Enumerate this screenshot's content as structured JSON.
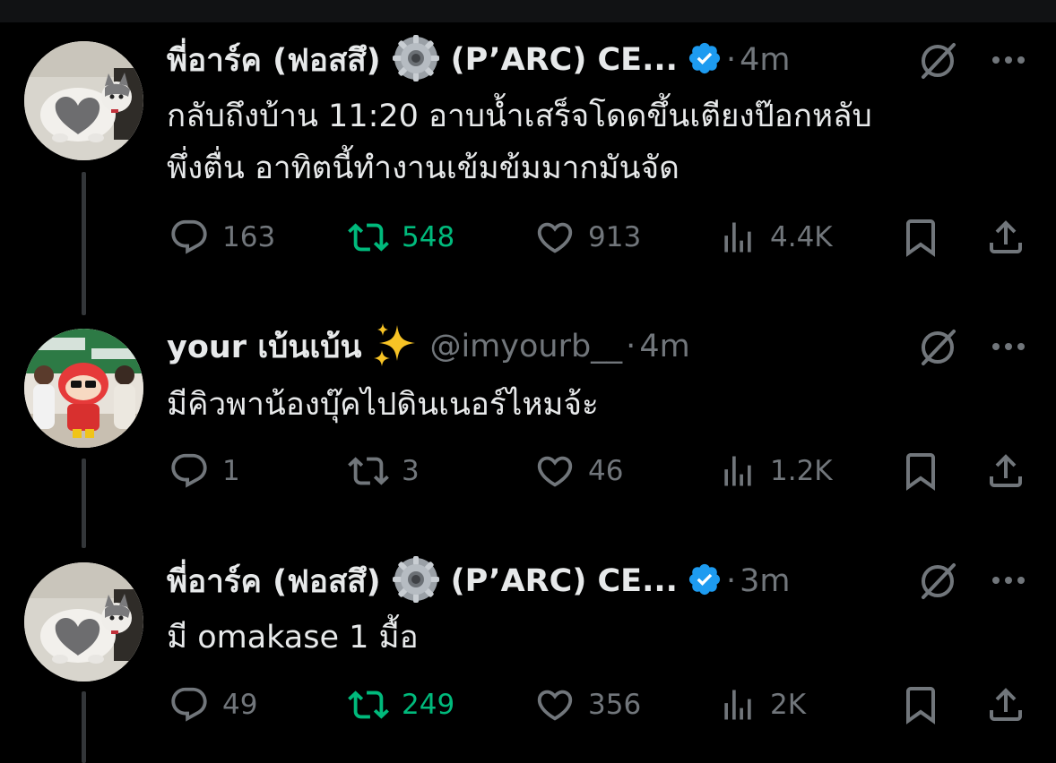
{
  "tweets": [
    {
      "name": "พี่อาร์ค (ฟอสสึ) ⚙️ (P’ARC) CE...",
      "name_text": "พี่อาร์ค (ฟอสสึ)",
      "name_suffix": "(P’ARC) CE...",
      "handle": "",
      "time": "4m",
      "verified": true,
      "text_lines": [
        "กลับถึงบ้าน 11:20 อาบน้ำเสร็จโดดขึ้นเตียงป๊อกหลับ",
        "พึ่งตื่น อาทิตนี้ทำงานเข้มข้มมากมันจัด"
      ],
      "replies": "163",
      "reposts": "548",
      "reposted": true,
      "likes": "913",
      "views": "4.4K",
      "avatar": "cat-avatar"
    },
    {
      "name_text": "your เบ้นเบ้น",
      "name_suffix": "",
      "handle": "@imyourb__",
      "time": "4m",
      "verified": false,
      "text_lines": [
        "มีคิวพาน้องบุ๊คไปดินเนอร์ไหมจ้ะ"
      ],
      "replies": "1",
      "reposts": "3",
      "reposted": false,
      "likes": "46",
      "views": "1.2K",
      "avatar": "group-photo-avatar"
    },
    {
      "name_text": "พี่อาร์ค (ฟอสสึ)",
      "name_suffix": "(P’ARC) CE...",
      "handle": "",
      "time": "3m",
      "verified": true,
      "text_lines": [
        "มี omakase 1 มื้อ"
      ],
      "replies": "49",
      "reposts": "249",
      "reposted": true,
      "likes": "356",
      "views": "2K",
      "avatar": "cat-avatar"
    }
  ],
  "separator": "·",
  "colors": {
    "background": "#000000",
    "text": "#e7e9ea",
    "muted": "#71767b",
    "repost_active": "#00ba7c",
    "verified": "#1d9bf0",
    "thread_line": "#333639"
  },
  "icons": [
    "reply-icon",
    "repost-icon",
    "like-icon",
    "views-icon",
    "bookmark-icon",
    "share-icon",
    "grok-icon",
    "more-icon",
    "verified-badge-icon",
    "gear-emoji-icon",
    "sparkles-emoji-icon"
  ]
}
